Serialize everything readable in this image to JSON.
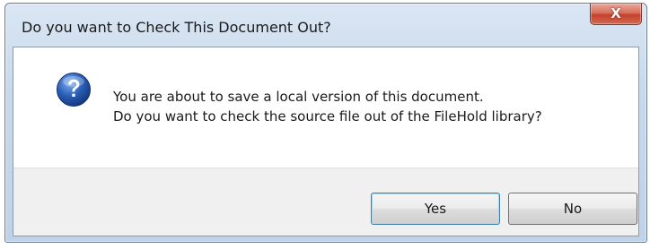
{
  "dialog": {
    "title": "Do you want to Check This Document Out?",
    "close_glyph": "X",
    "icon": "question-icon",
    "message_line1": "You are about to save a local version of this document.",
    "message_line2": "Do you want to check the source file out of the FileHold library?",
    "buttons": {
      "yes_label": "Yes",
      "no_label": "No"
    }
  },
  "colors": {
    "frame": "#c9d9ec",
    "close_button": "#c4412c",
    "footer": "#f0f0f0",
    "icon_blue": "#2b5fb8"
  }
}
